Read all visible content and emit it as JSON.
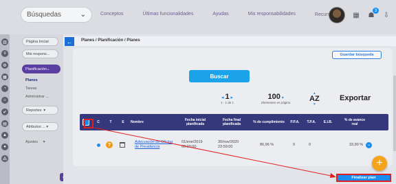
{
  "topbar": {
    "search_label": "Búsquedas",
    "nav": [
      "Conceptos",
      "Últimas funcionalidades",
      "Ayudas",
      "Mis responsabilidades",
      "Recursos"
    ],
    "notification_count": "3"
  },
  "sidebar": {
    "items": [
      {
        "label": "Página Inicial"
      },
      {
        "label": "Mis respons..."
      },
      {
        "label": "Planificación"
      },
      {
        "label": "Planes"
      },
      {
        "label": "Tareas"
      },
      {
        "label": "Administrar ..."
      },
      {
        "label": "Reportes"
      },
      {
        "label": "Atributos ..."
      },
      {
        "label": "Ajustes"
      }
    ]
  },
  "main": {
    "breadcrumb": "Planes / Planificación / Planes",
    "save_search_label": "Guardar búsqueda",
    "search_button_label": "Buscar",
    "pager": {
      "page": "1",
      "range": "1 - 1 de 1"
    },
    "per_page": {
      "value": "100",
      "label": "Elementos en página"
    },
    "sort_label": "AZ",
    "export_label": "Exportar",
    "columns": [
      "C",
      "T",
      "E",
      "Nombre",
      "Fecha inicial planificada",
      "Fecha final planificada",
      "% de cumplimiento",
      "P.P.A.",
      "T.P.A.",
      "E.I.B.",
      "% de avance real"
    ],
    "rows": [
      {
        "nombre": "Adecuación de Oficina de Presidencia",
        "fecha_inicial": "01/ene/2019 00:00:00",
        "fecha_final": "30/nov/2020 23:59:00",
        "cumplimiento": "86,96 %",
        "ppa": "0",
        "tpa": "0",
        "eib": "",
        "avance_real": "33,90 %"
      }
    ],
    "finalize_label": "Finalizar plan"
  },
  "colors": {
    "accent": "#1a8ef0",
    "header": "#35387a",
    "sidebar_active": "#5a3fa0",
    "highlight": "#e02020",
    "fab": "#f5a31a"
  }
}
